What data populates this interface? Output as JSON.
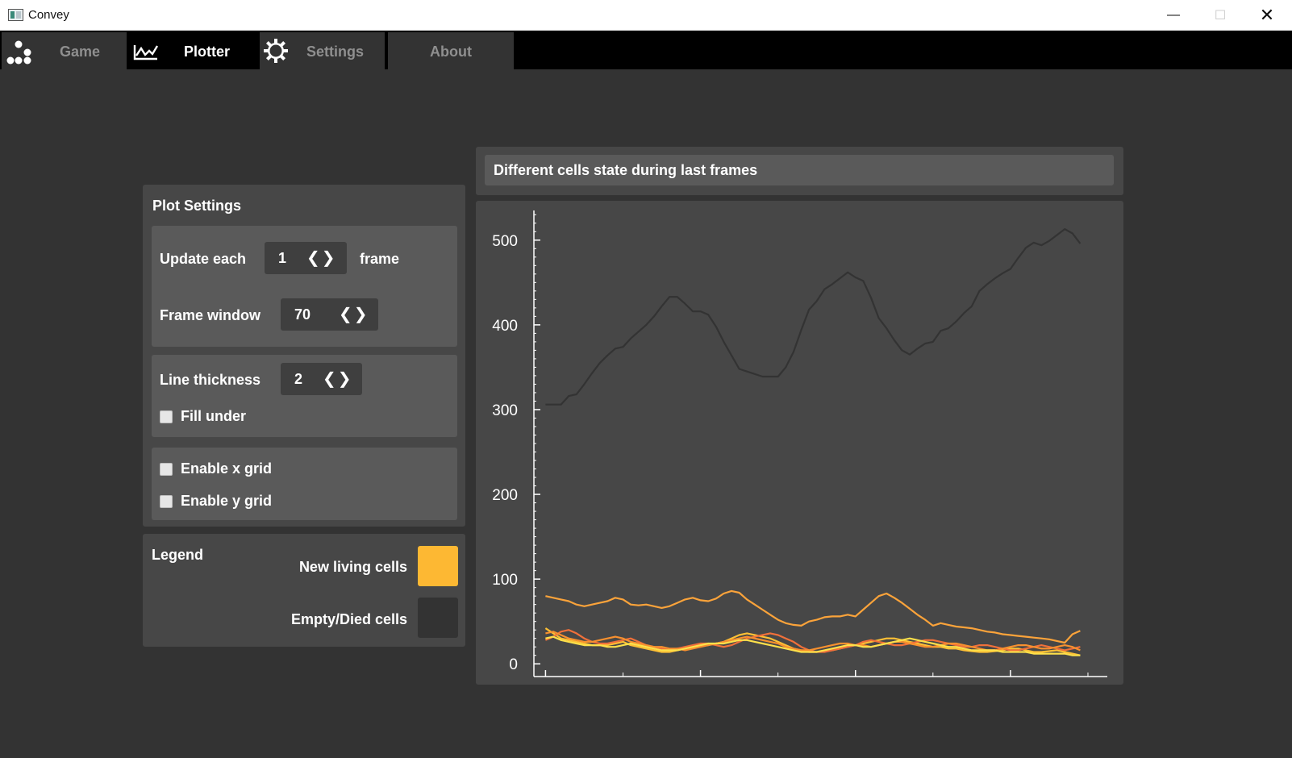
{
  "window": {
    "title": "Convey",
    "minimize_glyph": "—",
    "maximize_glyph": "☐",
    "close_glyph": "✕"
  },
  "tabs": [
    {
      "label": "Game",
      "icon": "cells-icon",
      "active": false
    },
    {
      "label": "Plotter",
      "icon": "plot-icon",
      "active": true
    },
    {
      "label": "Settings",
      "icon": "gear-icon",
      "active": false
    },
    {
      "label": "About",
      "icon": "",
      "active": false
    }
  ],
  "plot_settings": {
    "title": "Plot Settings",
    "update_each_label": "Update each",
    "update_each_value": "1",
    "update_each_suffix": "frame",
    "frame_window_label": "Frame window",
    "frame_window_value": "70",
    "line_thickness_label": "Line thickness",
    "line_thickness_value": "2",
    "spin_arrows": "❮❯",
    "fill_under_label": "Fill under",
    "fill_under_checked": false,
    "x_grid_label": "Enable x grid",
    "x_grid_checked": false,
    "y_grid_label": "Enable y grid",
    "y_grid_checked": false
  },
  "legend": {
    "title": "Legend",
    "items": [
      {
        "label": "New living cells",
        "color": "#fdb833"
      },
      {
        "label": "Empty/Died cells",
        "color": "#333333"
      }
    ]
  },
  "chart_title": "Different cells state during last frames",
  "chart_data": {
    "type": "line",
    "title": "Different cells state during last frames",
    "xlabel": "",
    "ylabel": "",
    "ylim": [
      -15,
      535
    ],
    "xlim": [
      -1.5,
      72.5
    ],
    "grid_x": false,
    "grid_y": false,
    "yticks": [
      0,
      100,
      200,
      300,
      400,
      500
    ],
    "x_major_ticks": [
      0,
      20,
      40,
      60
    ],
    "x_minor_ticks": [
      10,
      30,
      50,
      70
    ],
    "series": [
      {
        "name": "Empty/Died cells",
        "color": "#333333",
        "values": [
          306,
          306,
          306,
          316,
          318,
          330,
          343,
          355,
          364,
          372,
          374,
          384,
          392,
          400,
          410,
          422,
          433,
          433,
          425,
          416,
          416,
          412,
          398,
          380,
          364,
          348,
          345,
          342,
          339,
          339,
          339,
          350,
          368,
          394,
          418,
          428,
          442,
          448,
          455,
          462,
          456,
          452,
          432,
          408,
          396,
          382,
          370,
          365,
          372,
          378,
          380,
          393,
          396,
          404,
          414,
          422,
          440,
          448,
          455,
          461,
          466,
          479,
          491,
          497,
          494,
          499,
          506,
          513,
          508,
          496
        ]
      },
      {
        "color": "#fba33a",
        "values": [
          80,
          78,
          76,
          74,
          70,
          68,
          70,
          72,
          74,
          78,
          76,
          70,
          69,
          70,
          68,
          66,
          68,
          72,
          76,
          78,
          75,
          74,
          77,
          83,
          86,
          84,
          76,
          70,
          64,
          58,
          52,
          48,
          46,
          45,
          50,
          52,
          55,
          56,
          56,
          58,
          56,
          64,
          72,
          80,
          83,
          78,
          72,
          65,
          58,
          52,
          45,
          48,
          46,
          44,
          43,
          42,
          40,
          38,
          37,
          35,
          34,
          33,
          32,
          31,
          30,
          29,
          27,
          25,
          35,
          39
        ]
      },
      {
        "color": "#fdc035",
        "values": [
          42,
          36,
          30,
          28,
          26,
          24,
          22,
          22,
          22,
          24,
          26,
          22,
          20,
          18,
          16,
          14,
          14,
          16,
          18,
          20,
          22,
          22,
          24,
          26,
          30,
          34,
          36,
          34,
          32,
          30,
          26,
          22,
          18,
          16,
          14,
          14,
          15,
          16,
          18,
          20,
          22,
          24,
          26,
          28,
          30,
          30,
          28,
          26,
          24,
          22,
          20,
          20,
          18,
          18,
          16,
          15,
          14,
          14,
          15,
          16,
          18,
          18,
          16,
          14,
          14,
          15,
          16,
          14,
          12,
          10
        ]
      },
      {
        "color": "#f0703a",
        "values": [
          28,
          32,
          38,
          40,
          36,
          30,
          26,
          24,
          24,
          26,
          28,
          30,
          26,
          22,
          20,
          18,
          16,
          18,
          20,
          22,
          24,
          24,
          22,
          20,
          22,
          26,
          30,
          32,
          34,
          36,
          34,
          30,
          26,
          20,
          16,
          14,
          14,
          16,
          18,
          20,
          22,
          26,
          28,
          26,
          24,
          22,
          22,
          24,
          26,
          28,
          28,
          26,
          24,
          22,
          20,
          20,
          22,
          22,
          20,
          18,
          16,
          16,
          18,
          20,
          22,
          20,
          18,
          16,
          18,
          20
        ]
      },
      {
        "color": "#f7902f",
        "values": [
          36,
          38,
          34,
          30,
          28,
          26,
          26,
          28,
          30,
          32,
          30,
          26,
          24,
          22,
          20,
          20,
          18,
          18,
          16,
          18,
          20,
          22,
          24,
          26,
          28,
          30,
          32,
          30,
          28,
          26,
          24,
          20,
          18,
          16,
          16,
          18,
          20,
          22,
          24,
          24,
          22,
          22,
          20,
          22,
          24,
          26,
          26,
          24,
          22,
          20,
          20,
          22,
          24,
          24,
          22,
          20,
          18,
          16,
          16,
          18,
          20,
          22,
          22,
          20,
          18,
          18,
          20,
          22,
          20,
          16
        ]
      },
      {
        "color": "#fde04a",
        "values": [
          30,
          32,
          28,
          26,
          24,
          22,
          22,
          22,
          20,
          20,
          22,
          24,
          22,
          20,
          18,
          16,
          16,
          16,
          18,
          20,
          22,
          24,
          24,
          24,
          26,
          28,
          28,
          26,
          24,
          22,
          20,
          18,
          16,
          14,
          14,
          14,
          16,
          18,
          20,
          22,
          22,
          20,
          20,
          22,
          24,
          26,
          28,
          30,
          28,
          26,
          24,
          22,
          20,
          20,
          18,
          16,
          16,
          16,
          16,
          14,
          14,
          14,
          14,
          12,
          12,
          12,
          12,
          12,
          10,
          10
        ]
      }
    ]
  }
}
